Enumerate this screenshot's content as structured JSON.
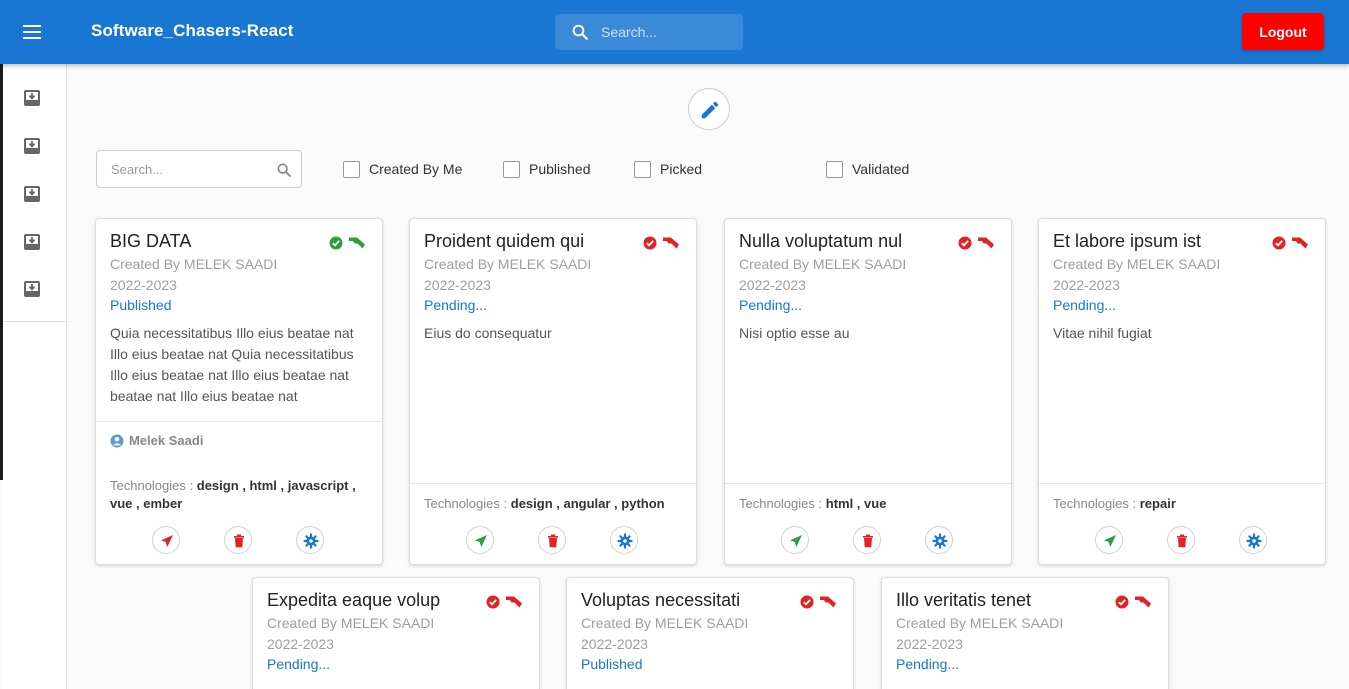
{
  "app": {
    "title": "Software_Chasers-React",
    "logout_label": "Logout"
  },
  "top_search": {
    "placeholder": "Search..."
  },
  "sidebar": {
    "items": [
      "inbox-icon",
      "inbox-icon",
      "inbox-icon",
      "inbox-icon",
      "inbox-icon"
    ]
  },
  "filters": {
    "search_placeholder": "Search...",
    "checkboxes": [
      {
        "label": "Created By Me",
        "checked": false
      },
      {
        "label": "Published",
        "checked": false
      },
      {
        "label": "Picked",
        "checked": false
      },
      {
        "label": "Validated",
        "checked": false
      }
    ]
  },
  "colors": {
    "primary": "#1976d2",
    "logout": "#ff0000",
    "success": "#2e9e3e",
    "danger": "#e02424"
  },
  "tech_label": "Technologies :",
  "cards": [
    {
      "title": "BIG DATA",
      "created_by": "Created By MELEK SAADI",
      "year": "2022-2023",
      "status": "Published",
      "validated": true,
      "description": "Quia necessitatibus Illo eius beatae nat Illo eius beatae nat Quia necessitatibus Illo eius beatae nat Illo eius beatae nat beatae nat Illo eius beatae nat",
      "owner": "Melek Saadi",
      "technologies": "design , html , javascript , vue , ember"
    },
    {
      "title": "Proident quidem qui",
      "created_by": "Created By MELEK SAADI",
      "year": "2022-2023",
      "status": "Pending...",
      "validated": false,
      "description": "Eius do consequatur",
      "technologies": "design , angular , python"
    },
    {
      "title": "Nulla voluptatum nul",
      "created_by": "Created By MELEK SAADI",
      "year": "2022-2023",
      "status": "Pending...",
      "validated": false,
      "description": "Nisi optio esse au",
      "technologies": "html , vue"
    },
    {
      "title": "Et labore ipsum ist",
      "created_by": "Created By MELEK SAADI",
      "year": "2022-2023",
      "status": "Pending...",
      "validated": false,
      "description": "Vitae nihil fugiat",
      "technologies": "repair"
    },
    {
      "title": "Expedita eaque volup",
      "created_by": "Created By MELEK SAADI",
      "year": "2022-2023",
      "status": "Pending...",
      "validated": false
    },
    {
      "title": "Voluptas necessitati",
      "created_by": "Created By MELEK SAADI",
      "year": "2022-2023",
      "status": "Published",
      "validated": false
    },
    {
      "title": "Illo veritatis tenet",
      "created_by": "Created By MELEK SAADI",
      "year": "2022-2023",
      "status": "Pending...",
      "validated": false
    }
  ]
}
